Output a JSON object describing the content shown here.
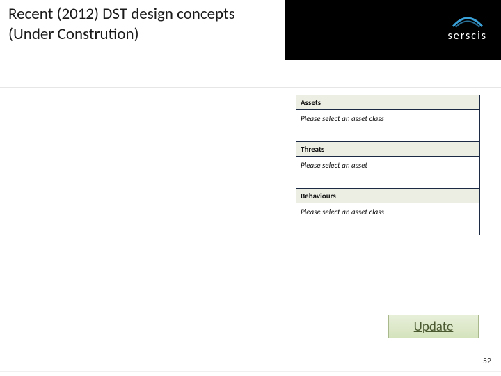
{
  "header": {
    "title_line1": "Recent (2012) DST design concepts",
    "title_line2": "(Under Constrution)",
    "logo_text": "serscis"
  },
  "panels": [
    {
      "title": "Assets",
      "placeholder": "Please select an asset class"
    },
    {
      "title": "Threats",
      "placeholder": "Please select an asset"
    },
    {
      "title": "Behaviours",
      "placeholder": "Please select an asset class"
    }
  ],
  "button": {
    "update_label": "Update"
  },
  "page_number": "52"
}
